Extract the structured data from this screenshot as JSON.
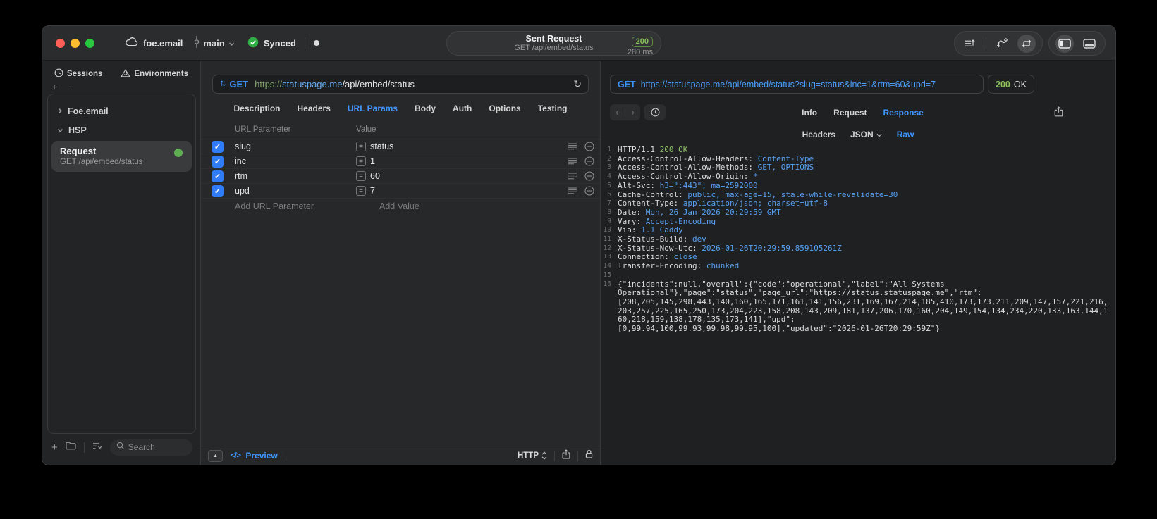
{
  "glyphs": {
    "plus": "+",
    "minus": "−",
    "collapse": "▲",
    "back": "‹",
    "forward": "›",
    "refresh": "↻",
    "stepper": "⇅",
    "dot": "",
    "check": "✓",
    "equals": "="
  },
  "colors": {
    "accent_blue": "#3f97ff",
    "method_blue": "#3b8df7",
    "code_value_blue": "#57a0f2",
    "success_green": "#8cc45f",
    "checkbox_blue": "#2f7cf6",
    "status_dot_green": "#5fae52"
  },
  "titlebar": {
    "project": "foe.email",
    "branch": "main",
    "sync_label": "Synced",
    "request_summary": {
      "title": "Sent Request",
      "subtitle": "GET /api/embed/status",
      "status_code": "200",
      "duration": "280 ms"
    }
  },
  "sidebar": {
    "tabs": [
      {
        "label": "Sessions"
      },
      {
        "label": "Environments"
      }
    ],
    "groups": [
      {
        "label": "Foe.email",
        "state": "collapsed"
      },
      {
        "label": "HSP",
        "state": "expanded"
      }
    ],
    "request_item": {
      "title": "Request",
      "subtitle": "GET /api/embed/status"
    },
    "search_placeholder": "Search"
  },
  "request_pane": {
    "method": "GET",
    "url": {
      "scheme": "https://",
      "host": "statuspage.me",
      "path": "/api/embed/status"
    },
    "tabs": [
      "Description",
      "Headers",
      "URL Params",
      "Body",
      "Auth",
      "Options",
      "Testing"
    ],
    "active_tab": "URL Params",
    "params": {
      "col_name": "URL Parameter",
      "col_value": "Value",
      "rows": [
        {
          "name": "slug",
          "value": "status",
          "enabled": true
        },
        {
          "name": "inc",
          "value": "1",
          "enabled": true
        },
        {
          "name": "rtm",
          "value": "60",
          "enabled": true
        },
        {
          "name": "upd",
          "value": "7",
          "enabled": true
        }
      ],
      "add_name": "Add URL Parameter",
      "add_value": "Add Value"
    },
    "footer": {
      "preview_icon": "</>",
      "preview_label": "Preview",
      "protocol": "HTTP"
    }
  },
  "response_pane": {
    "method": "GET",
    "url": "https://statuspage.me/api/embed/status?slug=status&inc=1&rtm=60&upd=7",
    "status_code": "200",
    "status_text": "OK",
    "tabs": [
      "Info",
      "Request",
      "Response"
    ],
    "active_tab": "Response",
    "subtabs": [
      "Headers",
      "JSON",
      "Raw"
    ],
    "active_subtab": "Raw",
    "raw_lines": [
      {
        "n": "1",
        "seg": [
          [
            "p",
            "HTTP/1.1 "
          ],
          [
            "g",
            "200 OK"
          ]
        ]
      },
      {
        "n": "2",
        "seg": [
          [
            "p",
            "Access-Control-Allow-Headers: "
          ],
          [
            "b",
            "Content-Type"
          ]
        ]
      },
      {
        "n": "3",
        "seg": [
          [
            "p",
            "Access-Control-Allow-Methods: "
          ],
          [
            "b",
            "GET, OPTIONS"
          ]
        ]
      },
      {
        "n": "4",
        "seg": [
          [
            "p",
            "Access-Control-Allow-Origin: "
          ],
          [
            "b",
            "*"
          ]
        ]
      },
      {
        "n": "5",
        "seg": [
          [
            "p",
            "Alt-Svc: "
          ],
          [
            "b",
            "h3=\":443\"; ma=2592000"
          ]
        ]
      },
      {
        "n": "6",
        "seg": [
          [
            "p",
            "Cache-Control: "
          ],
          [
            "b",
            "public, max-age=15, stale-while-revalidate=30"
          ]
        ]
      },
      {
        "n": "7",
        "seg": [
          [
            "p",
            "Content-Type: "
          ],
          [
            "b",
            "application/json; charset=utf-8"
          ]
        ]
      },
      {
        "n": "8",
        "seg": [
          [
            "p",
            "Date: "
          ],
          [
            "b",
            "Mon, 26 Jan 2026 20:29:59 GMT"
          ]
        ]
      },
      {
        "n": "9",
        "seg": [
          [
            "p",
            "Vary: "
          ],
          [
            "b",
            "Accept-Encoding"
          ]
        ]
      },
      {
        "n": "10",
        "seg": [
          [
            "p",
            "Via: "
          ],
          [
            "b",
            "1.1 Caddy"
          ]
        ]
      },
      {
        "n": "11",
        "seg": [
          [
            "p",
            "X-Status-Build: "
          ],
          [
            "b",
            "dev"
          ]
        ]
      },
      {
        "n": "12",
        "seg": [
          [
            "p",
            "X-Status-Now-Utc: "
          ],
          [
            "b",
            "2026-01-26T20:29:59.859105261Z"
          ]
        ]
      },
      {
        "n": "13",
        "seg": [
          [
            "p",
            "Connection: "
          ],
          [
            "b",
            "close"
          ]
        ]
      },
      {
        "n": "14",
        "seg": [
          [
            "p",
            "Transfer-Encoding: "
          ],
          [
            "b",
            "chunked"
          ]
        ]
      },
      {
        "n": "15",
        "seg": []
      },
      {
        "n": "16",
        "seg": [
          [
            "p",
            "{\"incidents\":null,\"overall\":{\"code\":\"operational\",\"label\":\"All Systems"
          ]
        ]
      },
      {
        "n": "",
        "seg": [
          [
            "p",
            "Operational\"},\"page\":\"status\",\"page_url\":\"https://status.statuspage.me\",\"rtm\":"
          ]
        ]
      },
      {
        "n": "",
        "seg": [
          [
            "p",
            "[208,205,145,298,443,140,160,165,171,161,141,156,231,169,167,214,185,410,173,173,211,209,147,157,221,216,"
          ]
        ]
      },
      {
        "n": "",
        "seg": [
          [
            "p",
            "203,257,225,165,250,173,204,223,158,208,143,209,181,137,206,170,160,204,149,154,134,234,220,133,163,144,1"
          ]
        ]
      },
      {
        "n": "",
        "seg": [
          [
            "p",
            "60,218,159,138,178,135,173,141],\"upd\":"
          ]
        ]
      },
      {
        "n": "",
        "seg": [
          [
            "p",
            "[0,99.94,100,99.93,99.98,99.95,100],\"updated\":\"2026-01-26T20:29:59Z\"}"
          ]
        ]
      }
    ]
  }
}
